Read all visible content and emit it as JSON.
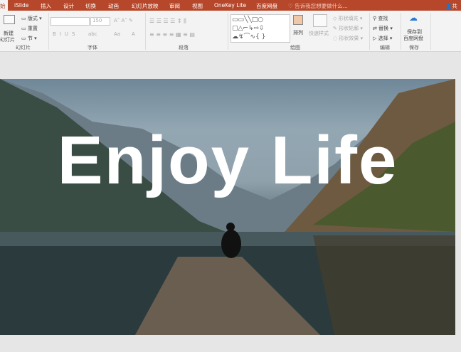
{
  "tabs": [
    {
      "label": "始",
      "active": true
    },
    {
      "label": "iSlide"
    },
    {
      "label": "插入"
    },
    {
      "label": "设计"
    },
    {
      "label": "切换"
    },
    {
      "label": "动画"
    },
    {
      "label": "幻灯片放映"
    },
    {
      "label": "审阅"
    },
    {
      "label": "视图"
    },
    {
      "label": "OneKey Lite"
    },
    {
      "label": "百度网盘"
    }
  ],
  "search_placeholder": "告诉我您想要做什么...",
  "share": "共享",
  "ribbon": {
    "slides": {
      "new_slide": "新建",
      "new_slide2": "幻灯片",
      "layout": "版式",
      "reset": "重置",
      "section": "节",
      "group": "幻灯片"
    },
    "font": {
      "font_size": "150",
      "group": "字体",
      "bold": "B",
      "italic": "I",
      "underline": "U",
      "strike": "S",
      "abc": "abc",
      "aa": "Aa",
      "color": "A"
    },
    "paragraph": {
      "group": "段落"
    },
    "drawing": {
      "arrange": "排列",
      "quick_styles": "快速样式",
      "fill": "形状填充",
      "outline": "形状轮廓",
      "effects": "形状效果",
      "group": "绘图"
    },
    "editing": {
      "find": "查找",
      "replace": "替换",
      "select": "选择",
      "group": "编辑"
    },
    "save": {
      "label1": "保存到",
      "label2": "百度网盘",
      "group": "保存"
    }
  },
  "slide": {
    "title": "Enjoy Life"
  }
}
